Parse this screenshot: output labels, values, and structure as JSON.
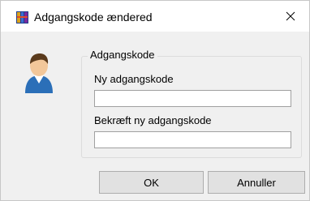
{
  "window": {
    "title": "Adgangskode ændered",
    "close_glyph": "×"
  },
  "icons": {
    "app": "app-icon",
    "avatar": "user-avatar-icon",
    "close": "close-icon"
  },
  "group": {
    "legend": "Adgangskode",
    "new_password_label": "Ny adgangskode",
    "new_password_value": "",
    "confirm_password_label": "Bekræft ny adgangskode",
    "confirm_password_value": ""
  },
  "buttons": {
    "ok_label": "OK",
    "cancel_label": "Annuller"
  },
  "colors": {
    "dialog_background": "#f0f0f0",
    "titlebar_background": "#ffffff",
    "button_background": "#e1e1e1"
  }
}
